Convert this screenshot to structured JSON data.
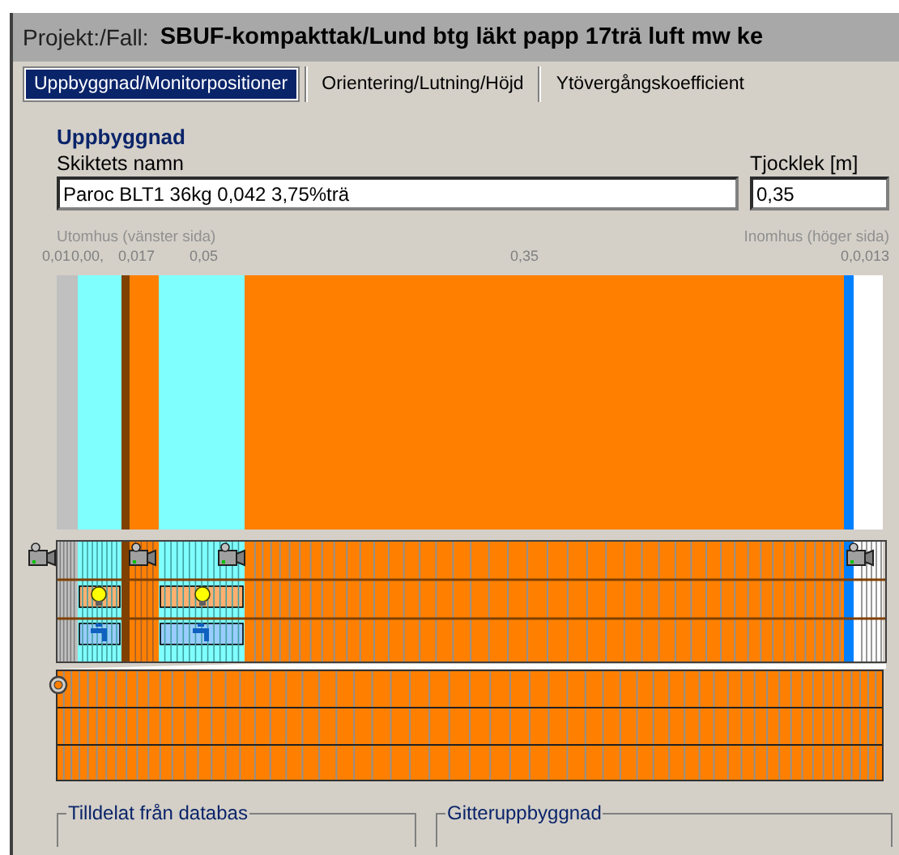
{
  "title_bar": {
    "label": "Projekt:/Fall:",
    "project": "SBUF-kompakttak/Lund btg läkt papp 17trä luft mw ke"
  },
  "tabs": [
    {
      "label": "Uppbyggnad/Monitorpositioner",
      "selected": true
    },
    {
      "label": "Orientering/Lutning/Höjd",
      "selected": false
    },
    {
      "label": "Ytövergångskoefficient",
      "selected": false
    }
  ],
  "section_title": "Uppbyggnad",
  "layer_name": {
    "label": "Skiktets namn",
    "value": "Paroc BLT1 36kg 0,042 3,75%trä"
  },
  "thickness": {
    "label": "Tjocklek [m]",
    "value": "0,35"
  },
  "side_labels": {
    "outside": "Utomhus (vänster sida)",
    "inside": "Inomhus (höger sida)"
  },
  "scale_labels": [
    "0,01",
    "0,00,",
    "0,017",
    "0,05",
    "0,35",
    "0,0,013"
  ],
  "layers": [
    {
      "color": "#c0c0c0"
    },
    {
      "color": "#80ffff"
    },
    {
      "color": "#804000"
    },
    {
      "color": "#ff8000"
    },
    {
      "color": "#80ffff"
    },
    {
      "color": "#ff8000"
    },
    {
      "color": "#0080ff"
    },
    {
      "color": "#ffffff"
    }
  ],
  "group_boxes": [
    "Tilldelat från databas",
    "Gitteruppbyggnad"
  ]
}
